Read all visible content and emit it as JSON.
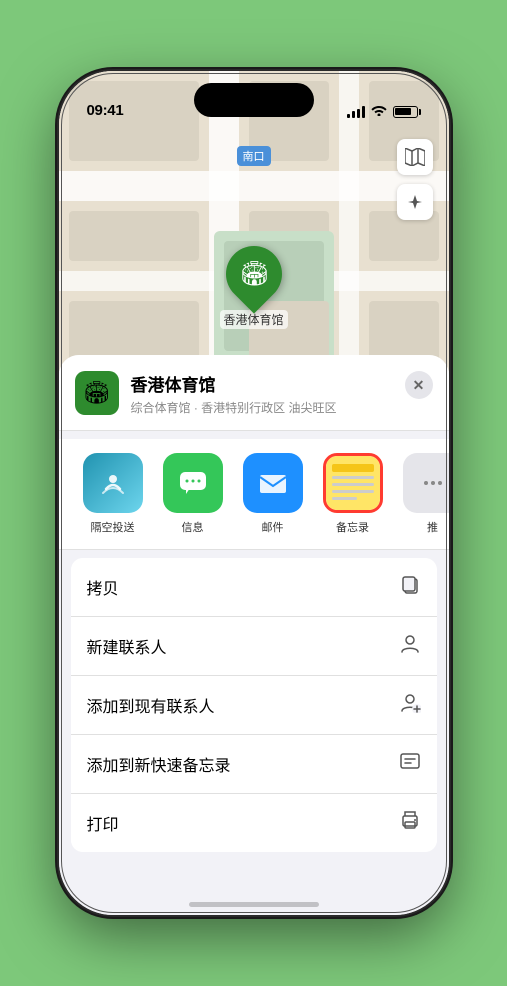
{
  "status_bar": {
    "time": "09:41",
    "location_icon": "▶"
  },
  "map": {
    "label": "南口",
    "venue_pin_label": "香港体育馆",
    "venue_pin_emoji": "🏟"
  },
  "map_controls": [
    {
      "icon": "🗺",
      "name": "map-type"
    },
    {
      "icon": "⬆",
      "name": "compass"
    }
  ],
  "venue_card": {
    "name": "香港体育馆",
    "subtitle": "综合体育馆 · 香港特别行政区 油尖旺区",
    "close_label": "✕"
  },
  "share_items": [
    {
      "id": "airdrop",
      "label": "隔空投送",
      "type": "airdrop"
    },
    {
      "id": "messages",
      "label": "信息",
      "type": "messages"
    },
    {
      "id": "mail",
      "label": "邮件",
      "type": "mail"
    },
    {
      "id": "notes",
      "label": "备忘录",
      "type": "notes"
    },
    {
      "id": "more",
      "label": "推",
      "type": "more"
    }
  ],
  "action_items": [
    {
      "id": "copy",
      "label": "拷贝",
      "icon": "⎘"
    },
    {
      "id": "new-contact",
      "label": "新建联系人",
      "icon": "👤"
    },
    {
      "id": "add-contact",
      "label": "添加到现有联系人",
      "icon": "👤+"
    },
    {
      "id": "quick-note",
      "label": "添加到新快速备忘录",
      "icon": "📋"
    },
    {
      "id": "print",
      "label": "打印",
      "icon": "🖨"
    }
  ]
}
